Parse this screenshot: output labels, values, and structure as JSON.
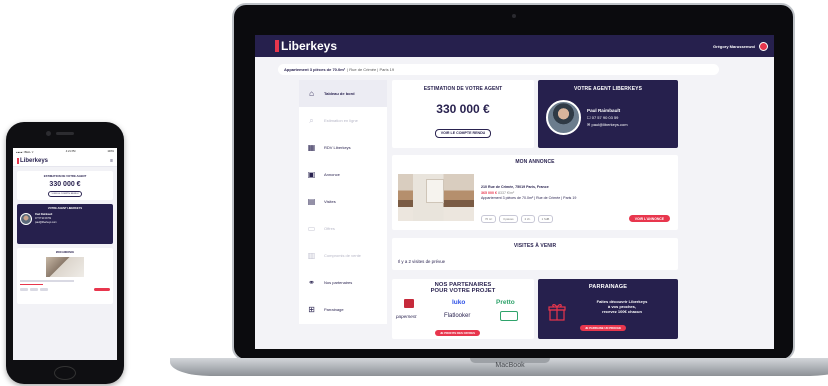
{
  "brand": {
    "name": "Liberkeys",
    "accent": "#e8364d",
    "navy": "#26204d"
  },
  "laptop": {
    "model_label": "MacBook"
  },
  "topbar": {
    "user_name": "Grégory Marussenwol"
  },
  "breadcrumb": {
    "bold": "Appartement 3 pièces de 70.0m²",
    "rest": "| Rue de Crimée | Paris 19"
  },
  "sidebar": {
    "items": [
      {
        "label": "Tableau de bord",
        "icon": "home-icon",
        "state": "active"
      },
      {
        "label": "Estimation en ligne",
        "icon": "search-icon",
        "state": "disabled"
      },
      {
        "label": "RDV Liberkeys",
        "icon": "calendar-icon",
        "state": "normal"
      },
      {
        "label": "Annonce",
        "icon": "listing-icon",
        "state": "normal"
      },
      {
        "label": "Visites",
        "icon": "visits-icon",
        "state": "normal"
      },
      {
        "label": "Offres",
        "icon": "offers-icon",
        "state": "disabled"
      },
      {
        "label": "Compromis de vente",
        "icon": "contract-icon",
        "state": "disabled"
      },
      {
        "label": "Nos partenaires",
        "icon": "handshake-icon",
        "state": "normal"
      },
      {
        "label": "Parrainage",
        "icon": "gift-icon",
        "state": "normal"
      }
    ]
  },
  "estimation": {
    "title": "ESTIMATION DE VOTRE AGENT",
    "price": "330 000 €",
    "button": "VOIR LE COMPTE RENDU"
  },
  "agent": {
    "title": "VOTRE AGENT LIBERKEYS",
    "name": "Paul Raimbault",
    "phone": "07 57 90 03 59",
    "email": "paul@liberkeys.com"
  },
  "annonce": {
    "title": "MON ANNONCE",
    "address": "210 Rue de Crimée, 75019 Paris, France",
    "price": "365 000 €",
    "price_m2": "8337 €/m²",
    "details": "Appartement 3 pièces de 70.0m² | Rue de Crimée | Paris 19",
    "tags": [
      "70 m²",
      "3 pièces",
      "2 ch.",
      "1 SdB"
    ],
    "button": "VOIR L'ANNONCE"
  },
  "visites": {
    "title": "VISITES À VENIR",
    "text": "Il y a 2 visites de prévue"
  },
  "partners": {
    "title_line1": "NOS PARTENAIRES",
    "title_line2": "POUR VOTRE PROJET",
    "logos": [
      "luko",
      "Pretto",
      "papernest",
      "Flatlooker"
    ],
    "button": "JE PROFITE DES OFFRES"
  },
  "parrainage": {
    "title": "PARRAINAGE",
    "line1": "Faites découvrir Liberkeys",
    "line2": "à vos proches,",
    "line3": "recevez 100€ chacun",
    "button": "JE PARRAINE UN PROCHE"
  },
  "phone": {
    "status_left": "●●●●○ BELL ᯤ",
    "status_time": "4:21 PM",
    "status_right": "100%",
    "estimation_title": "ESTIMATION DE VOTRE AGENT",
    "price": "330 000 €",
    "button": "VOIR LE COMPTE RENDU",
    "agent_title": "VOTRE AGENT LIBERKEYS",
    "agent_name": "Paul Raimbault",
    "agent_phone": "07 57 90 03 59",
    "agent_email": "paul@liberkeys.com",
    "annonce_title": "MON ANNONCE"
  }
}
